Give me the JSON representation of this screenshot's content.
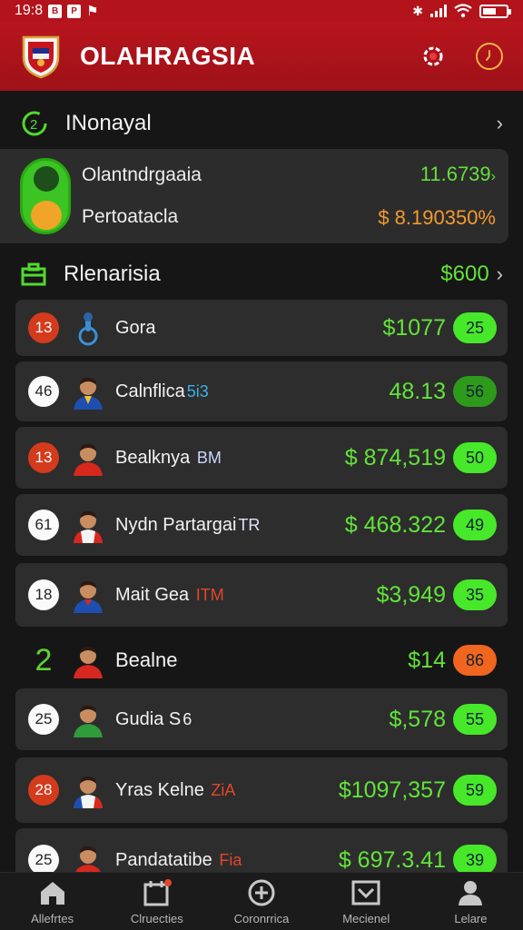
{
  "status": {
    "time": "19:8",
    "icons": [
      "msg-icon",
      "shield-icon",
      "flag-icon"
    ],
    "right_icons": [
      "bluetooth-icon",
      "signal-icon",
      "wifi-icon",
      "battery-icon"
    ]
  },
  "header": {
    "title": "OLAHRAGSIA",
    "icons": [
      "crest-logo",
      "record-icon",
      "timer-icon"
    ]
  },
  "section1": {
    "label": "INonayal",
    "icon": "refresh-icon"
  },
  "summary": {
    "name1": "Olantndrgaaia",
    "name2": "Pertoatacla",
    "value1": "11.6739",
    "value2": "$ 8.190350%"
  },
  "section2": {
    "label": "Rlenarisia",
    "amount": "$600",
    "icon": "briefcase-icon"
  },
  "rows": [
    {
      "rank": "13",
      "name": "Gora",
      "tag": "",
      "money": "$1077",
      "badge": "25"
    },
    {
      "rank": "46",
      "name": "Calnflica",
      "tag": "5i3",
      "money": "48.13",
      "badge": "56"
    },
    {
      "rank": "13",
      "name": "Bealknya",
      "tag": "BM",
      "money": "$ 874,519",
      "badge": "50"
    },
    {
      "rank": "61",
      "name": "Nydn Partargai",
      "tag": "TR",
      "money": "$ 468.322",
      "badge": "49"
    },
    {
      "rank": "18",
      "name": "Mait Gea",
      "tag": "ITM",
      "money": "$3,949",
      "badge": "35"
    },
    {
      "rank": "2",
      "name": "Bealne",
      "tag": "",
      "money": "$14",
      "badge": "86"
    },
    {
      "rank": "25",
      "name": "Gudia S",
      "tag": "6",
      "money": "$,578",
      "badge": "55"
    },
    {
      "rank": "28",
      "name": "Yras Kelne",
      "tag": "ZiA",
      "money": "$1097,357",
      "badge": "59"
    },
    {
      "rank": "25",
      "name": "Pandatatibe",
      "tag": "Fia",
      "money": "$ 697.3.41",
      "badge": "39"
    }
  ],
  "nav": [
    {
      "label": "Allefrtes",
      "icon": "home-icon"
    },
    {
      "label": "Clruecties",
      "icon": "calendar-icon"
    },
    {
      "label": "Coronrrica",
      "icon": "add-circle-icon"
    },
    {
      "label": "Mecienel",
      "icon": "inbox-icon"
    },
    {
      "label": "Lelare",
      "icon": "profile-icon"
    }
  ],
  "colors": {
    "accent_red": "#b3141c",
    "money_green": "#63e23a",
    "badge_orange": "#f0661e",
    "badge_green": "#47e82a"
  }
}
